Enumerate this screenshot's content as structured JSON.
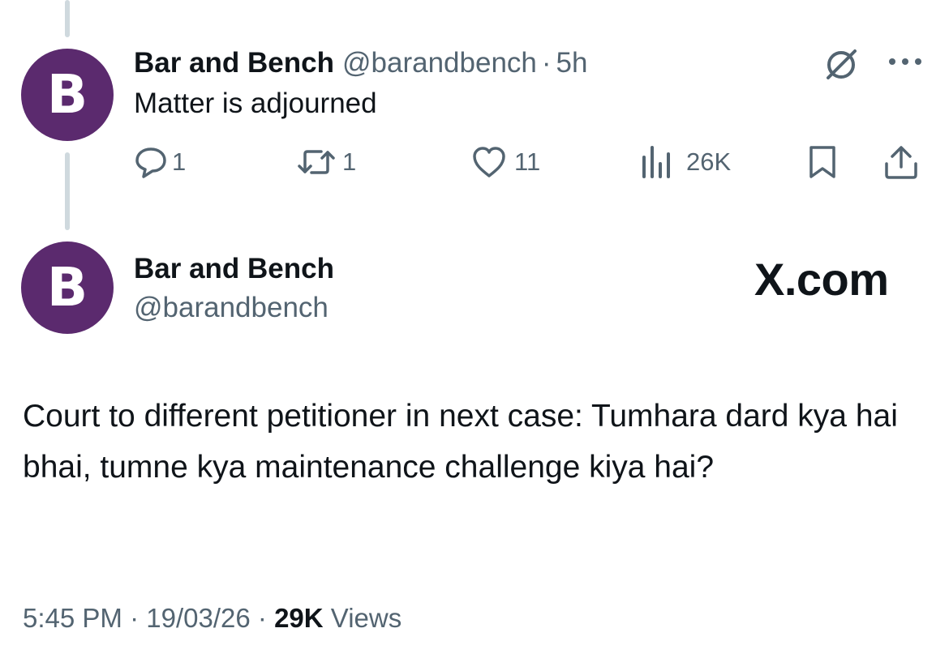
{
  "reply": {
    "author_name": "Bar and Bench",
    "handle": "@barandbench",
    "separator": "·",
    "time_ago": "5h",
    "text": "Matter is adjourned",
    "avatar_letter": "B",
    "actions": {
      "replies": "1",
      "reposts": "1",
      "likes": "11",
      "views": "26K"
    }
  },
  "main_tweet": {
    "author_name": "Bar and Bench",
    "handle": "@barandbench",
    "avatar_letter": "B",
    "brand": "X.com",
    "text": "Court to different petitioner in next case: Tumhara dard kya hai bhai, tumne kya maintenance challenge kiya hai?",
    "time": "5:45 PM",
    "separator": "·",
    "date": "19/03/26",
    "views_count": "29K",
    "views_label": "Views"
  },
  "colors": {
    "avatar_bg": "#5b2a6e",
    "text_primary": "#0f1419",
    "text_secondary": "#536471",
    "thread_line": "#cfd9de"
  },
  "icons": [
    "grok-icon",
    "more-icon",
    "reply-icon",
    "repost-icon",
    "like-icon",
    "views-icon",
    "bookmark-icon",
    "share-icon"
  ]
}
